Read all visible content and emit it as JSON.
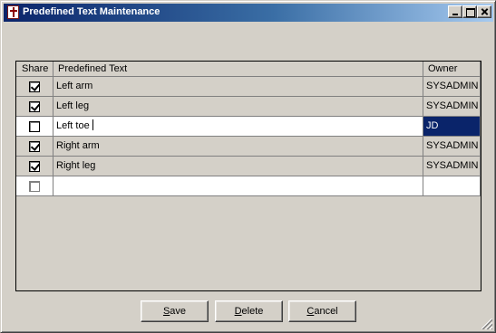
{
  "window": {
    "title": "Predefined Text Maintenance"
  },
  "grid": {
    "columns": {
      "share": "Share",
      "text": "Predefined Text",
      "owner": "Owner"
    },
    "rows": [
      {
        "share": true,
        "text": "Left arm",
        "owner": "SYSADMIN"
      },
      {
        "share": true,
        "text": "Left leg",
        "owner": "SYSADMIN"
      },
      {
        "share": false,
        "text": "Left toe",
        "owner": "JD"
      },
      {
        "share": true,
        "text": "Right arm",
        "owner": "SYSADMIN"
      },
      {
        "share": true,
        "text": "Right leg",
        "owner": "SYSADMIN"
      },
      {
        "share": false,
        "text": "",
        "owner": ""
      }
    ]
  },
  "buttons": {
    "save": {
      "mnemonic": "S",
      "rest": "ave"
    },
    "delete": {
      "mnemonic": "D",
      "rest": "elete"
    },
    "cancel": {
      "mnemonic": "C",
      "rest": "ancel"
    }
  }
}
